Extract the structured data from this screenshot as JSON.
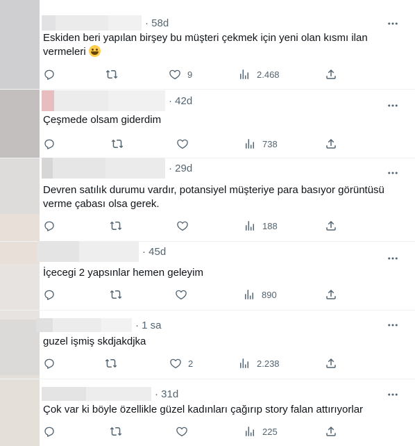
{
  "icons": {
    "reply": "reply-icon",
    "retweet": "retweet-icon",
    "like": "heart-icon",
    "views": "views-icon",
    "share": "share-icon",
    "more": "more-icon"
  },
  "colors": {
    "muted": "#536471",
    "text": "#0f1419",
    "divider": "#eff3f4"
  },
  "tweets": [
    {
      "time": "· 58d",
      "text": "Eskiden beri yapılan birşey bu müşteri çekmek için yeni olan kısmı ilan vermeleri",
      "likes": "9",
      "views": "2.468"
    },
    {
      "time": "· 42d",
      "text": "Çeşmede olsam giderdim",
      "likes": "",
      "views": "738"
    },
    {
      "time": "· 29d",
      "text": "Devren satılık durumu vardır, potansiyel müşteriye para basıyor görüntüsü verme çabası olsa gerek.",
      "likes": "",
      "views": "188"
    },
    {
      "time": "· 45d",
      "text": "İçecegi 2 yapsınlar hemen geleyim",
      "likes": "",
      "views": "890"
    },
    {
      "time": "· 1 sa",
      "text": "guzel işmiş skdjakdjka",
      "likes": "2",
      "views": "2.238"
    },
    {
      "time": "· 31d",
      "text": "Çok  var ki böyle özellikle güzel kadınları çağırıp story falan attırıyorlar",
      "likes": "",
      "views": "225"
    }
  ]
}
